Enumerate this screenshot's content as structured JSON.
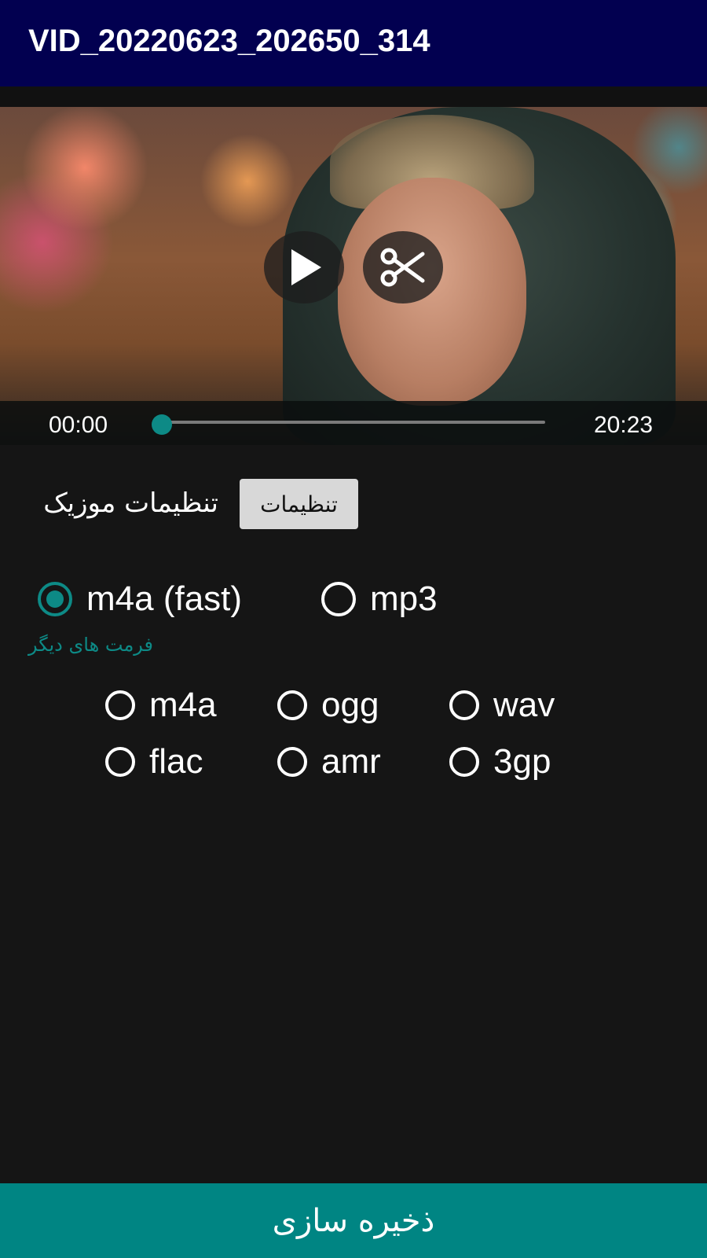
{
  "appbar": {
    "title": "VID_20220623_202650_314"
  },
  "player": {
    "current_time": "00:00",
    "total_time": "20:23",
    "progress": 0,
    "play_icon": "play-icon",
    "cut_icon": "scissors-icon"
  },
  "music_settings": {
    "label": "تنظیمات موزیک",
    "button_label": "تنظیمات"
  },
  "main_formats": [
    {
      "label": "m4a (fast)",
      "checked": true
    },
    {
      "label": "mp3",
      "checked": false
    }
  ],
  "other_formats_title": "فرمت های دیگر",
  "other_formats": [
    {
      "label": "m4a"
    },
    {
      "label": "ogg"
    },
    {
      "label": "wav"
    },
    {
      "label": "flac"
    },
    {
      "label": "amr"
    },
    {
      "label": "3gp"
    }
  ],
  "save_label": "ذخیره سازی",
  "colors": {
    "appbar": "#020050",
    "accent": "#0d8a86",
    "save_bar": "#008583",
    "background": "#151515"
  }
}
